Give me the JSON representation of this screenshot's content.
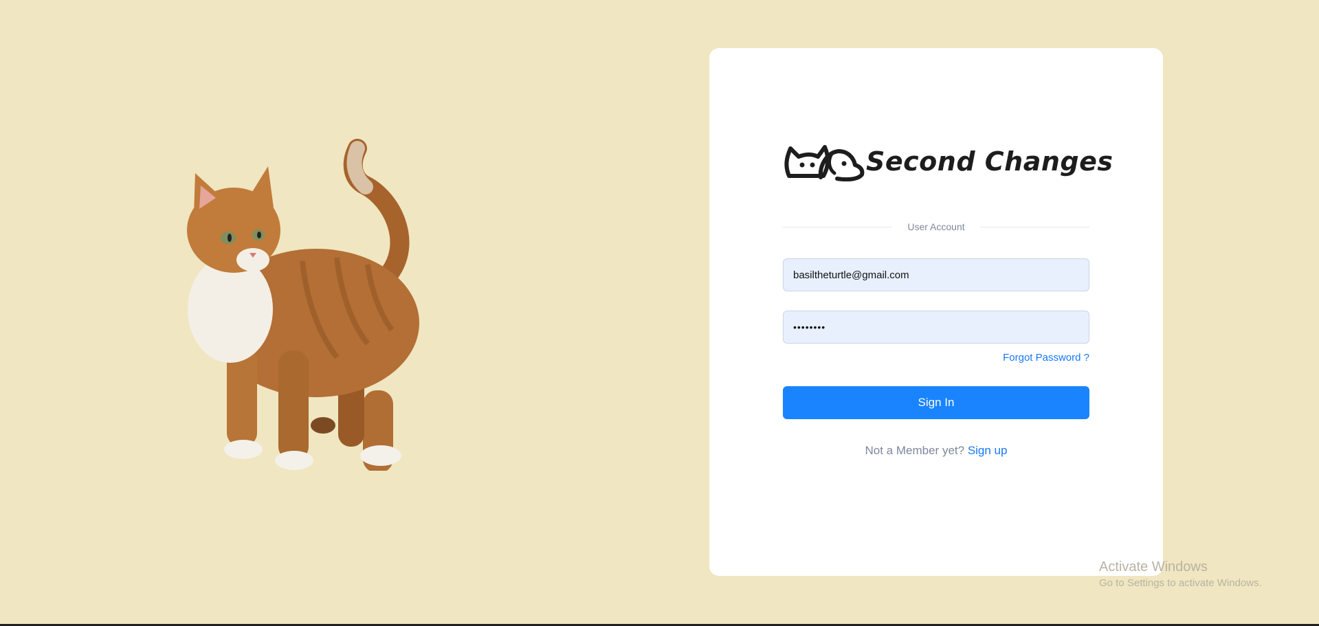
{
  "colors": {
    "page_background": "#f0e6c1",
    "card_background": "#ffffff",
    "accent": "#1a84ff",
    "link": "#1677ff",
    "input_background": "#e8f0fe",
    "muted_text": "#7d879c"
  },
  "illustration": {
    "icon": "orange-cat-photo"
  },
  "logo": {
    "icon": "cat-and-dog-outline-icon",
    "text": "Second Changes"
  },
  "login": {
    "section_label": "User Account",
    "email_value": "basiltheturtle@gmail.com",
    "password_value": "••••••••",
    "forgot_password_label": "Forgot Password ?",
    "sign_in_label": "Sign In",
    "signup_prompt": "Not a Member yet?",
    "signup_label": "Sign up"
  },
  "system_overlay": {
    "title": "Activate Windows",
    "subtitle": "Go to Settings to activate Windows."
  }
}
